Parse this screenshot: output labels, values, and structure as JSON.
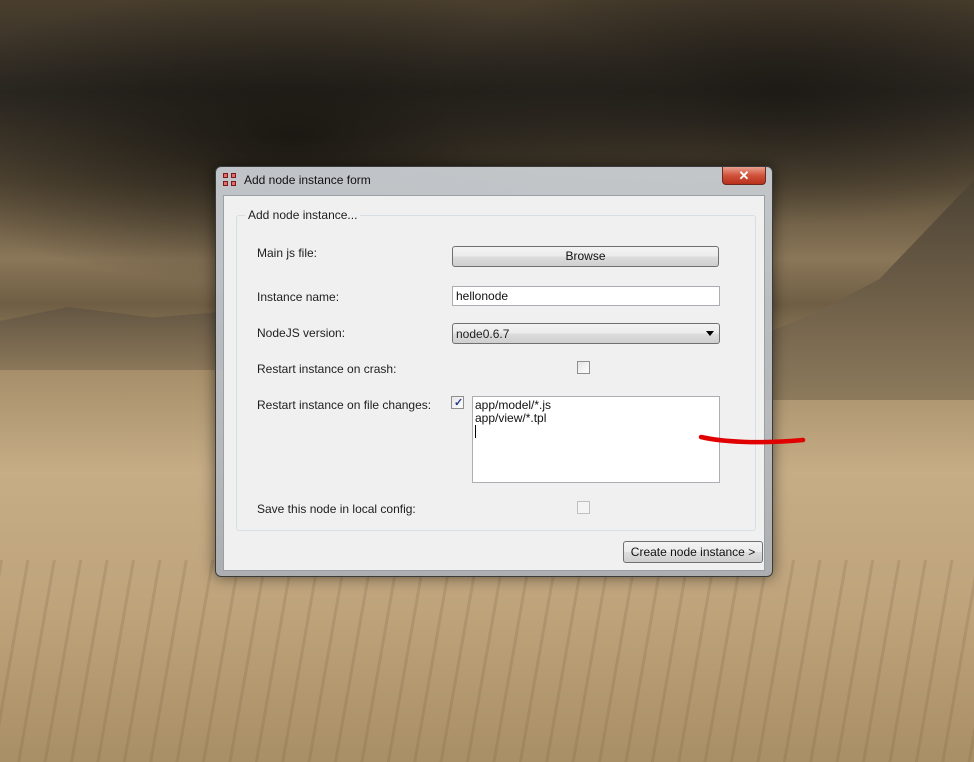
{
  "window": {
    "title": "Add node instance form",
    "close_glyph": "✕"
  },
  "group": {
    "title": "Add node instance..."
  },
  "form": {
    "main_js_label": "Main  js file:",
    "browse_label": "Browse",
    "instance_name_label": "Instance name:",
    "instance_name_value": "hellonode",
    "nodejs_version_label": "NodeJS version:",
    "nodejs_version_selected": "node0.6.7",
    "restart_on_crash_label": "Restart instance on crash:",
    "restart_on_crash_checked": false,
    "restart_on_changes_label": "Restart instance on file changes:",
    "restart_on_changes_checked": true,
    "watch_patterns": [
      "app/model/*.js",
      "app/view/*.tpl",
      ""
    ],
    "save_local_label": "Save this node in local config:",
    "save_local_checked": false,
    "save_local_enabled": false,
    "create_button_label": "Create node instance >"
  },
  "icons": {
    "app_icon": "app-icon",
    "dropdown_arrow": "chevron-down-icon",
    "check": "check-icon"
  },
  "colors": {
    "annotation_red": "#e00000",
    "close_button": "#c8402a",
    "check_color": "#243b8c"
  }
}
